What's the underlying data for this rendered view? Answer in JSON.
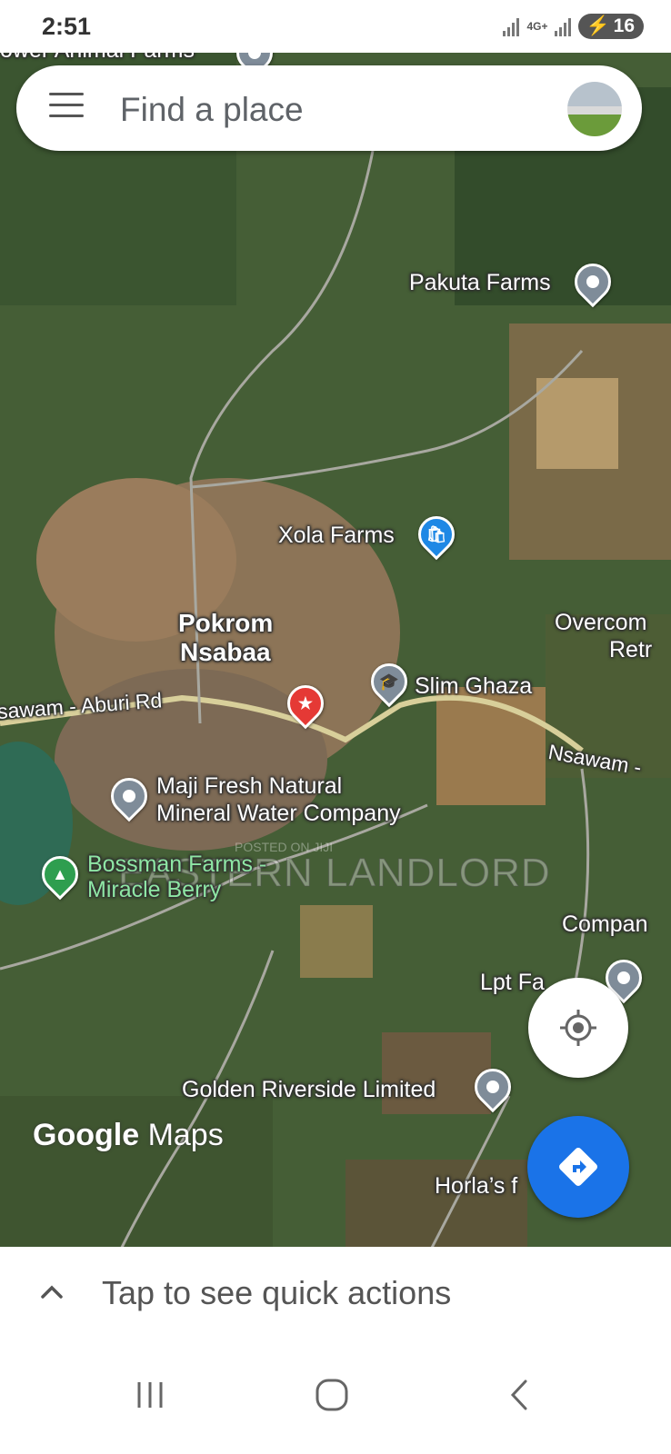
{
  "status_bar": {
    "time": "2:51",
    "network": "4G+",
    "battery": "16"
  },
  "search": {
    "placeholder": "Find a place"
  },
  "map": {
    "labels": {
      "top_cut": "ower Animal Farms",
      "pakuta": "Pakuta Farms",
      "xola": "Xola Farms",
      "pokrom_1": "Pokrom",
      "pokrom_2": "Nsabaa",
      "overcome_1": "Overcom",
      "overcome_2": "Retr",
      "road_left": "sawam - Aburi Rd",
      "road_right": "Nsawam -",
      "slim_ghaza": "Slim Ghaza",
      "maji_1": "Maji Fresh Natural",
      "maji_2": "Mineral Water Company",
      "bossman_1": "Bossman Farms -",
      "bossman_2": "Miracle Berry",
      "company": "Compan",
      "lpt": "Lpt Fa",
      "golden": "Golden Riverside Limited",
      "horlas": "Horla’s f"
    },
    "watermark": "EASTERN LANDLORD",
    "watermark_small": "POSTED ON JIJI",
    "logo_google": "Google",
    "logo_maps": "Maps",
    "pin_colors": {
      "default": "#7f8c99",
      "shopping": "#1e88e5",
      "selected": "#e53935",
      "park": "#2e9e4f"
    }
  },
  "bottom_panel": {
    "text": "Tap to see quick actions"
  },
  "colors": {
    "accent": "#1a73e8"
  }
}
